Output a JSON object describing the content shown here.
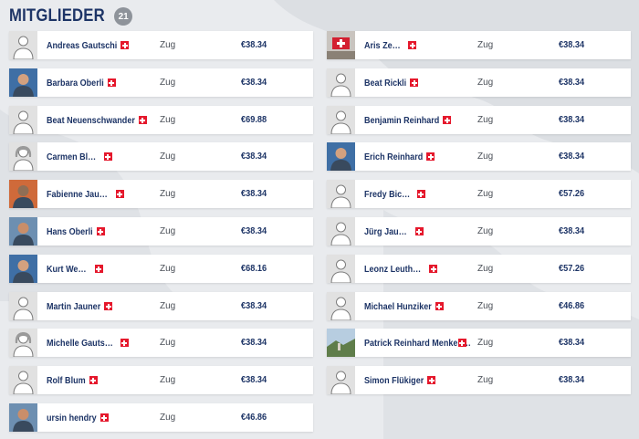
{
  "header": {
    "title": "MITGLIEDER",
    "count": "21"
  },
  "colors": {
    "accent": "#1d3466",
    "badge": "#8e939a",
    "flag": "#e5182c"
  },
  "members": [
    {
      "name": "Andreas Gautschi",
      "city": "Zug",
      "amount": "€38.34",
      "avatar": "placeholder"
    },
    {
      "name": "Aris Zemp",
      "city": "Zug",
      "amount": "€38.34",
      "avatar": "swiss-photo"
    },
    {
      "name": "Barbara Oberli",
      "city": "Zug",
      "amount": "€38.34",
      "avatar": "photo"
    },
    {
      "name": "Beat Rickli",
      "city": "Zug",
      "amount": "€38.34",
      "avatar": "placeholder"
    },
    {
      "name": "Beat Neuenschwander",
      "city": "Zug",
      "amount": "€69.88",
      "avatar": "placeholder"
    },
    {
      "name": "Benjamin Reinhard",
      "city": "Zug",
      "amount": "€38.34",
      "avatar": "placeholder"
    },
    {
      "name": "Carmen Blum",
      "city": "Zug",
      "amount": "€38.34",
      "avatar": "placeholder-female"
    },
    {
      "name": "Erich Reinhard",
      "city": "Zug",
      "amount": "€38.34",
      "avatar": "photo"
    },
    {
      "name": "Fabienne Jauner",
      "city": "Zug",
      "amount": "€38.34",
      "avatar": "photo"
    },
    {
      "name": "Fredy Bickel",
      "city": "Zug",
      "amount": "€57.26",
      "avatar": "placeholder"
    },
    {
      "name": "Hans Oberli",
      "city": "Zug",
      "amount": "€38.34",
      "avatar": "photo"
    },
    {
      "name": "Jürg Jauner",
      "city": "Zug",
      "amount": "€38.34",
      "avatar": "placeholder"
    },
    {
      "name": "Kurt Weber",
      "city": "Zug",
      "amount": "€68.16",
      "avatar": "photo"
    },
    {
      "name": "Leonz Leuthard",
      "city": "Zug",
      "amount": "€57.26",
      "avatar": "placeholder"
    },
    {
      "name": "Martin Jauner",
      "city": "Zug",
      "amount": "€38.34",
      "avatar": "placeholder"
    },
    {
      "name": "Michael Hunziker",
      "city": "Zug",
      "amount": "€46.86",
      "avatar": "placeholder"
    },
    {
      "name": "Michelle Gautschi",
      "city": "Zug",
      "amount": "€38.34",
      "avatar": "placeholder-female"
    },
    {
      "name": "Patrick Reinhard Menken…",
      "city": "Zug",
      "amount": "€38.34",
      "avatar": "landscape-photo"
    },
    {
      "name": "Rolf Blum",
      "city": "Zug",
      "amount": "€38.34",
      "avatar": "placeholder"
    },
    {
      "name": "Simon Flükiger",
      "city": "Zug",
      "amount": "€38.34",
      "avatar": "placeholder"
    },
    {
      "name": "ursin hendry",
      "city": "Zug",
      "amount": "€46.86",
      "avatar": "photo"
    }
  ]
}
